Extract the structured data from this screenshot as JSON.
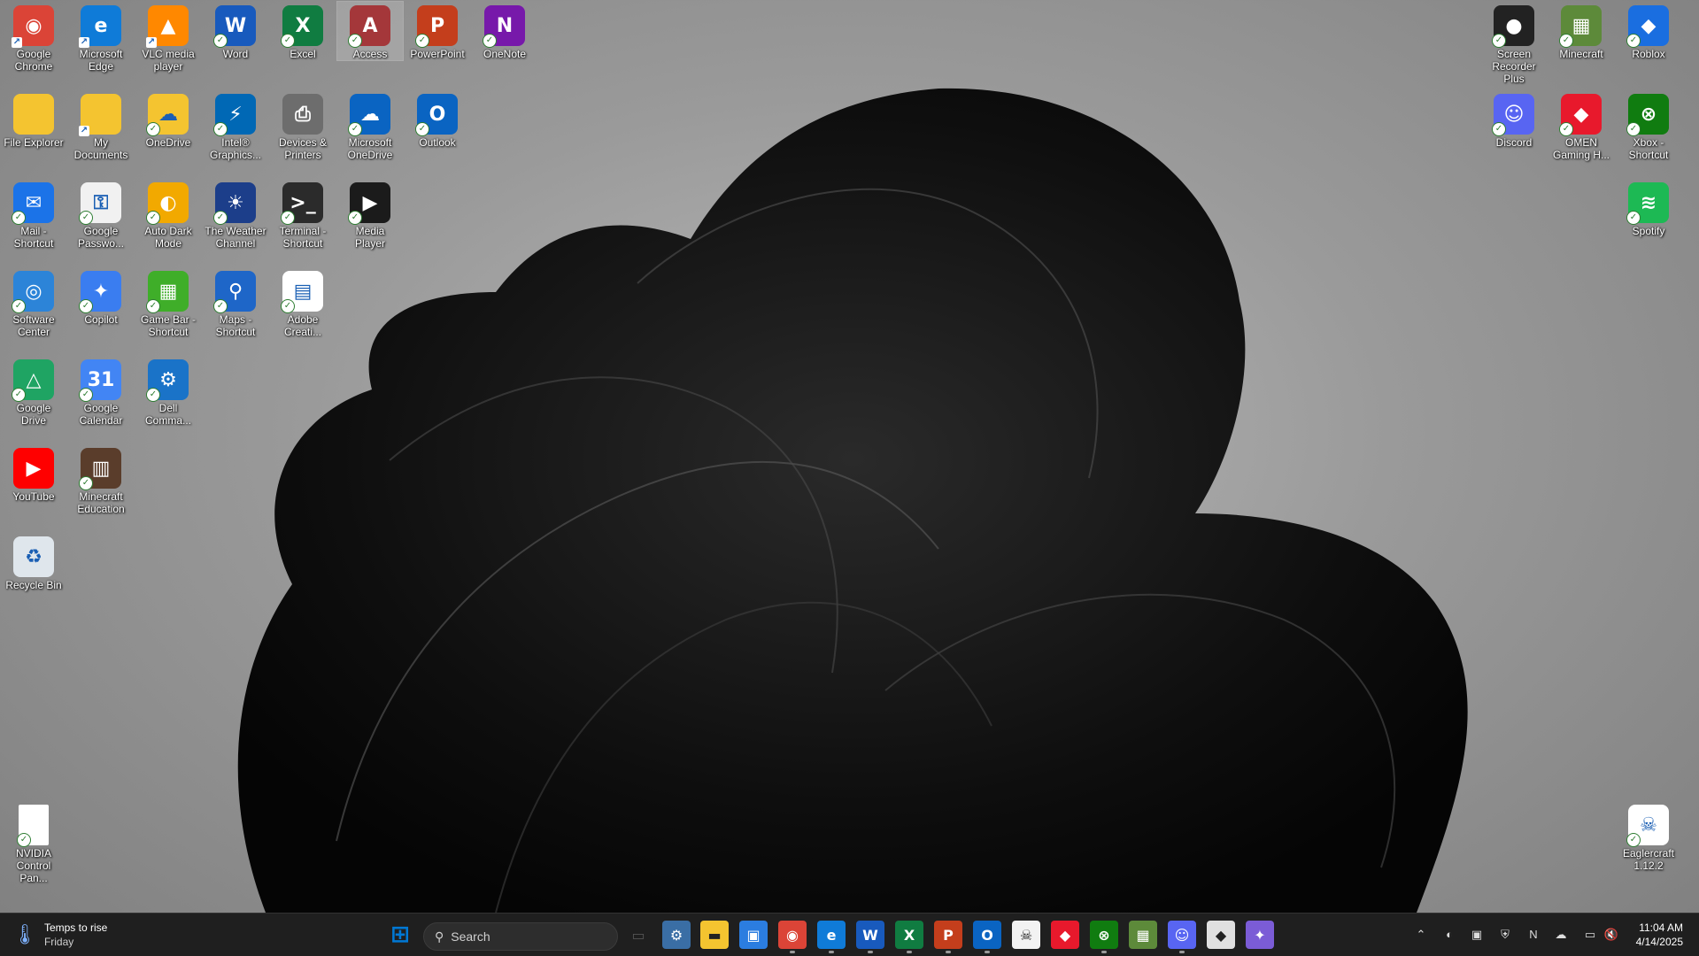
{
  "desktop": {
    "left_icons": [
      {
        "label": "Google Chrome",
        "icon": "chrome-icon",
        "color": "#db4437",
        "glyph": "◉",
        "badge": "shortcut"
      },
      {
        "label": "Microsoft Edge",
        "icon": "edge-icon",
        "color": "#0f7bd8",
        "glyph": "e",
        "badge": "shortcut"
      },
      {
        "label": "VLC media player",
        "icon": "vlc-icon",
        "color": "#ff8800",
        "glyph": "▲",
        "badge": "shortcut"
      },
      {
        "label": "Word",
        "icon": "word-icon",
        "color": "#185abd",
        "glyph": "W",
        "badge": "check"
      },
      {
        "label": "Excel",
        "icon": "excel-icon",
        "color": "#107c41",
        "glyph": "X",
        "badge": "check"
      },
      {
        "label": "Access",
        "icon": "access-icon",
        "color": "#a4373a",
        "glyph": "A",
        "badge": "check",
        "selected": true
      },
      {
        "label": "PowerPoint",
        "icon": "powerpoint-icon",
        "color": "#c43e1c",
        "glyph": "P",
        "badge": "check"
      },
      {
        "label": "OneNote",
        "icon": "onenote-icon",
        "color": "#7719aa",
        "glyph": "N",
        "badge": "check"
      },
      {
        "label": "File Explorer",
        "icon": "folder-icon",
        "color": "#f4c430",
        "glyph": "",
        "badge": "none"
      },
      {
        "label": "My Documents",
        "icon": "folder-icon",
        "color": "#f4c430",
        "glyph": "",
        "badge": "shortcut"
      },
      {
        "label": "OneDrive",
        "icon": "onedrive-folder-icon",
        "color": "#f4c430",
        "glyph": "☁",
        "badge": "check"
      },
      {
        "label": "Intel® Graphics...",
        "icon": "intel-graphics-icon",
        "color": "#0068b5",
        "glyph": "⚡",
        "badge": "check"
      },
      {
        "label": "Devices & Printers",
        "icon": "printer-icon",
        "color": "#6d6d6d",
        "glyph": "⎙",
        "badge": "none"
      },
      {
        "label": "Microsoft OneDrive",
        "icon": "onedrive-icon",
        "color": "#0a64c2",
        "glyph": "☁",
        "badge": "check"
      },
      {
        "label": "Outlook",
        "icon": "outlook-icon",
        "color": "#0a64c2",
        "glyph": "O",
        "badge": "check"
      },
      {
        "label": "Mail - Shortcut",
        "icon": "mail-icon",
        "color": "#1b73e8",
        "glyph": "✉",
        "badge": "check"
      },
      {
        "label": "Google Passwo...",
        "icon": "key-icon",
        "color": "#f1f1f1",
        "glyph": "⚿",
        "badge": "check"
      },
      {
        "label": "Auto Dark Mode",
        "icon": "auto-dark-icon",
        "color": "#f2a900",
        "glyph": "◐",
        "badge": "check"
      },
      {
        "label": "The Weather Channel",
        "icon": "weather-channel-icon",
        "color": "#1c3e8a",
        "glyph": "☀",
        "badge": "check"
      },
      {
        "label": "Terminal - Shortcut",
        "icon": "terminal-icon",
        "color": "#2b2b2b",
        "glyph": ">_",
        "badge": "check"
      },
      {
        "label": "Media Player",
        "icon": "media-player-icon",
        "color": "#1b1b1b",
        "glyph": "▶",
        "badge": "check"
      },
      {
        "label": "Software Center",
        "icon": "software-center-icon",
        "color": "#2c84d8",
        "glyph": "◎",
        "badge": "check"
      },
      {
        "label": "Copilot",
        "icon": "copilot-icon",
        "color": "#3a7df0",
        "glyph": "✦",
        "badge": "check"
      },
      {
        "label": "Game Bar - Shortcut",
        "icon": "game-bar-icon",
        "color": "#3fae29",
        "glyph": "▦",
        "badge": "check"
      },
      {
        "label": "Maps - Shortcut",
        "icon": "maps-icon",
        "color": "#1e66c8",
        "glyph": "⚲",
        "badge": "check"
      },
      {
        "label": "Adobe Creati...",
        "icon": "adobe-icon",
        "color": "#ffffff",
        "glyph": "▤",
        "badge": "check"
      },
      {
        "label": "Google Drive",
        "icon": "google-drive-icon",
        "color": "#1fa463",
        "glyph": "△",
        "badge": "check"
      },
      {
        "label": "Google Calendar",
        "icon": "calendar-icon",
        "color": "#4285f4",
        "glyph": "31",
        "badge": "check"
      },
      {
        "label": "Dell Comma...",
        "icon": "dell-command-icon",
        "color": "#1a73c8",
        "glyph": "⚙",
        "badge": "check"
      },
      {
        "label": "YouTube",
        "icon": "youtube-icon",
        "color": "#ff0000",
        "glyph": "▶",
        "badge": "none"
      },
      {
        "label": "Minecraft Education",
        "icon": "minecraft-education-icon",
        "color": "#5a3d2b",
        "glyph": "▥",
        "badge": "check"
      },
      {
        "label": "Recycle Bin",
        "icon": "recycle-bin-icon",
        "color": "#dfe6ec",
        "glyph": "♻",
        "badge": "none"
      },
      {
        "label": "NVIDIA Control Pan...",
        "icon": "file-icon",
        "color": "#ffffff",
        "glyph": "",
        "badge": "check"
      }
    ],
    "right_icons": [
      {
        "label": "Screen Recorder Plus",
        "icon": "screen-recorder-icon",
        "color": "#222222",
        "glyph": "●",
        "badge": "check"
      },
      {
        "label": "Minecraft",
        "icon": "minecraft-icon",
        "color": "#5d8a3a",
        "glyph": "▦",
        "badge": "check"
      },
      {
        "label": "Roblox",
        "icon": "roblox-icon",
        "color": "#1a6ee0",
        "glyph": "◆",
        "badge": "check"
      },
      {
        "label": "Discord",
        "icon": "discord-icon",
        "color": "#5865f2",
        "glyph": "☺",
        "badge": "check"
      },
      {
        "label": "OMEN Gaming H...",
        "icon": "omen-icon",
        "color": "#e8192c",
        "glyph": "◆",
        "badge": "check"
      },
      {
        "label": "Xbox - Shortcut",
        "icon": "xbox-icon",
        "color": "#107c10",
        "glyph": "⊗",
        "badge": "check"
      },
      {
        "label": "Spotify",
        "icon": "spotify-icon",
        "color": "#1db954",
        "glyph": "≋",
        "badge": "check"
      },
      {
        "label": "Eaglercraft 1.12.2",
        "icon": "eaglercraft-icon",
        "color": "#ffffff",
        "glyph": "☠",
        "badge": "check"
      }
    ]
  },
  "taskbar": {
    "weather_title": "Temps to rise",
    "weather_sub": "Friday",
    "search_placeholder": "Search",
    "time": "11:04 AM",
    "date": "4/14/2025",
    "pinned": [
      {
        "name": "start-button",
        "icon": "windows-icon",
        "color": "#0078d4",
        "glyph": "⊞"
      },
      {
        "name": "task-view-button",
        "icon": "task-view-icon",
        "color": "#555555",
        "glyph": "▭"
      },
      {
        "name": "settings-app",
        "icon": "gear-icon",
        "color": "#3a6ea5",
        "glyph": "⚙"
      },
      {
        "name": "file-explorer-app",
        "icon": "folder-icon",
        "color": "#f4c430",
        "glyph": "▬"
      },
      {
        "name": "store-app",
        "icon": "store-icon",
        "color": "#2b7de0",
        "glyph": "▣"
      },
      {
        "name": "chrome-app",
        "icon": "chrome-icon",
        "color": "#db4437",
        "glyph": "◉"
      },
      {
        "name": "edge-app",
        "icon": "edge-icon",
        "color": "#0f7bd8",
        "glyph": "e"
      },
      {
        "name": "word-app",
        "icon": "word-icon",
        "color": "#185abd",
        "glyph": "W"
      },
      {
        "name": "excel-app",
        "icon": "excel-icon",
        "color": "#107c41",
        "glyph": "X"
      },
      {
        "name": "powerpoint-app",
        "icon": "powerpoint-icon",
        "color": "#c43e1c",
        "glyph": "P"
      },
      {
        "name": "outlook-app",
        "icon": "outlook-icon",
        "color": "#0a64c2",
        "glyph": "O"
      },
      {
        "name": "eaglercraft-app",
        "icon": "eaglercraft-icon",
        "color": "#f2f2f2",
        "glyph": "☠"
      },
      {
        "name": "omen-app",
        "icon": "omen-icon",
        "color": "#e8192c",
        "glyph": "◆"
      },
      {
        "name": "xbox-app",
        "icon": "xbox-icon",
        "color": "#107c10",
        "glyph": "⊗"
      },
      {
        "name": "minecraft-app",
        "icon": "minecraft-icon",
        "color": "#5d8a3a",
        "glyph": "▦"
      },
      {
        "name": "discord-app",
        "icon": "discord-icon",
        "color": "#5865f2",
        "glyph": "☺"
      },
      {
        "name": "roblox-app",
        "icon": "roblox-icon",
        "color": "#e0e0e0",
        "glyph": "◆"
      },
      {
        "name": "m365-app",
        "icon": "m365-icon",
        "color": "#7b5cd6",
        "glyph": "✦"
      }
    ],
    "tray": [
      {
        "name": "show-hidden-icons",
        "icon": "chevron-up-icon",
        "glyph": "⌃"
      },
      {
        "name": "tray-auto-dark",
        "icon": "auto-dark-icon",
        "glyph": "◐"
      },
      {
        "name": "tray-printer",
        "icon": "printer-icon",
        "glyph": "▣"
      },
      {
        "name": "tray-defender",
        "icon": "shield-icon",
        "glyph": "⛨"
      },
      {
        "name": "tray-onenote",
        "icon": "onenote-icon",
        "glyph": "N"
      },
      {
        "name": "tray-onedrive",
        "icon": "cloud-icon",
        "glyph": "☁"
      },
      {
        "name": "tray-network",
        "icon": "network-icon",
        "glyph": "▭"
      },
      {
        "name": "tray-volume",
        "icon": "volume-muted-icon",
        "glyph": "🔇"
      }
    ]
  }
}
